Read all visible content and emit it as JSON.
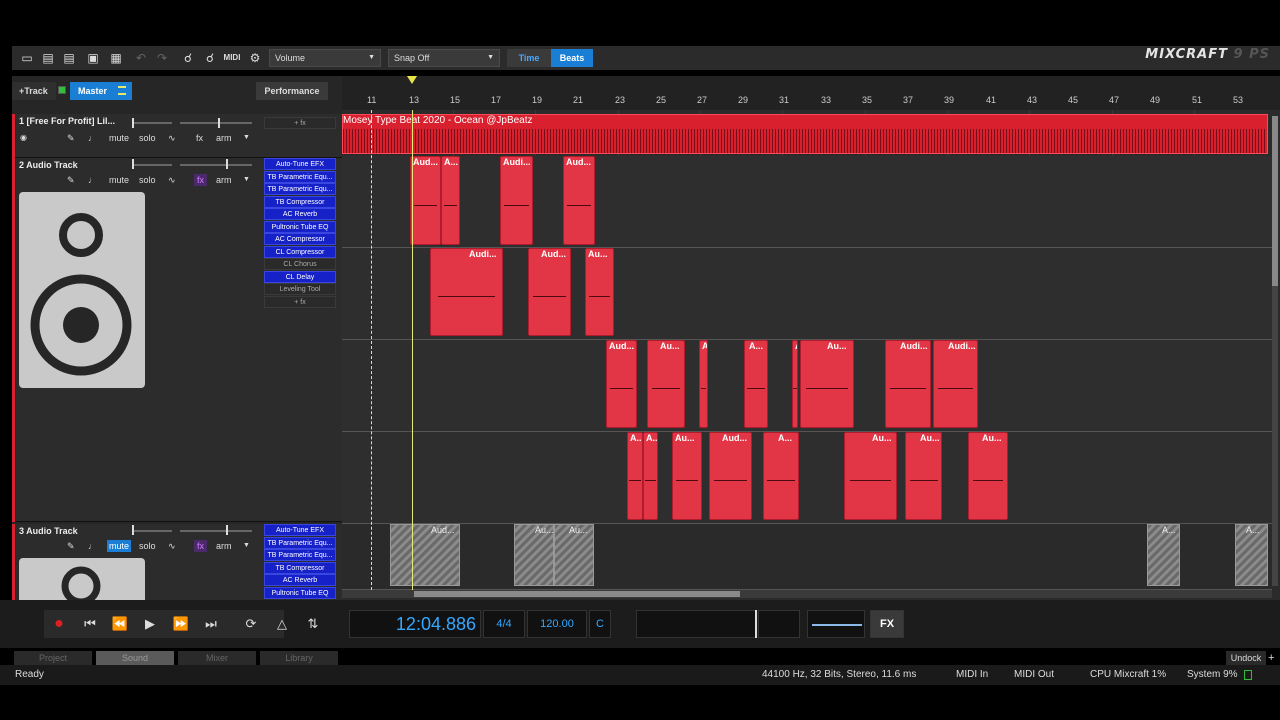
{
  "toolbar": {
    "param_dropdown": "Volume",
    "snap_dropdown": "Snap Off",
    "time_label": "Time",
    "beats_label": "Beats",
    "logo_text": "MIXCRAFT",
    "logo_version": "9 PS"
  },
  "track_header": {
    "add_track": "+Track",
    "master": "Master",
    "performance": "Performance"
  },
  "tracks": [
    {
      "name": "1 [Free For Profit] Lil...",
      "add_fx": "+ fx"
    },
    {
      "name": "2 Audio Track",
      "effects": [
        "Auto-Tune EFX",
        "TB Parametric Equ...",
        "TB Parametric Equ...",
        "TB Compressor",
        "AC Reverb",
        "Pultronic Tube EQ",
        "AC Compressor",
        "CL Compressor",
        "CL Chorus",
        "CL Delay",
        "Leveling Tool"
      ],
      "add_fx": "+ fx"
    },
    {
      "name": "3 Audio Track",
      "effects": [
        "Auto-Tune EFX",
        "TB Parametric Equ...",
        "TB Parametric Equ...",
        "TB Compressor",
        "AC Reverb",
        "Pultronic Tube EQ"
      ]
    }
  ],
  "controls": {
    "mute": "mute",
    "solo": "solo",
    "fx": "fx",
    "arm": "arm"
  },
  "ruler": {
    "bars": [
      "11",
      "13",
      "15",
      "17",
      "19",
      "21",
      "23",
      "25",
      "27",
      "29",
      "31",
      "33",
      "35",
      "37",
      "39",
      "41",
      "43",
      "45",
      "47",
      "49",
      "51",
      "53"
    ]
  },
  "track1_clip_title": "Mosey  Type Beat 2020 - Ocean  @JpBeatz",
  "clips": {
    "lane1": [
      "Aud...",
      "A...",
      "Audi...",
      "Aud..."
    ],
    "lane2": [
      "Audi...",
      "Aud...",
      "Au..."
    ],
    "lane3": [
      "Aud...",
      "Au...",
      "A",
      "A...",
      "A",
      "Au...",
      "Audi...",
      "Audi..."
    ],
    "lane4": [
      "A...",
      "A...",
      "Au...",
      "Aud...",
      "A...",
      "Au...",
      "Au...",
      "Au..."
    ],
    "track3": [
      "Aud...",
      "Au...",
      "Au...",
      "A...",
      "A..."
    ]
  },
  "transport": {
    "time": "12:04.886",
    "signature": "4/4",
    "tempo": "120.00",
    "key": "C",
    "fx": "FX"
  },
  "bottom_tabs": [
    "Project",
    "Sound",
    "Mixer",
    "Library"
  ],
  "undock": "Undock",
  "status": {
    "ready": "Ready",
    "audio_format": "44100 Hz, 32 Bits, Stereo, 11.6 ms",
    "midi_in": "MIDI In",
    "midi_out": "MIDI Out",
    "cpu": "CPU Mixcraft 1%",
    "system": "System 9%"
  }
}
